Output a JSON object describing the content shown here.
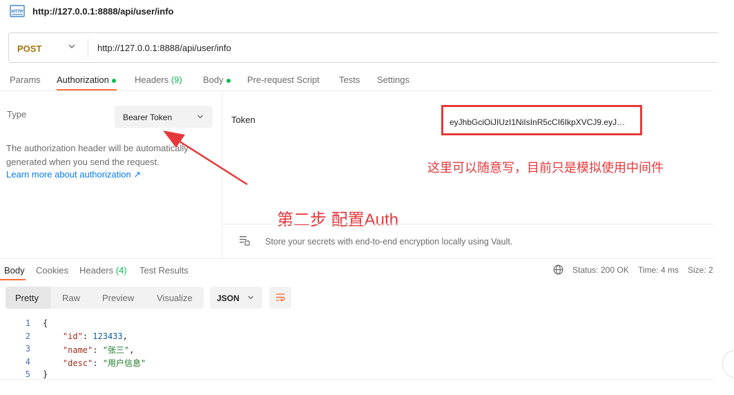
{
  "title": {
    "icon": "http-file-icon",
    "text": "http://127.0.0.1:8888/api/user/info"
  },
  "request": {
    "method": "POST",
    "url": "http://127.0.0.1:8888/api/user/info"
  },
  "tabs": [
    {
      "label": "Params"
    },
    {
      "label": "Authorization",
      "dot": true
    },
    {
      "label": "Headers",
      "count": "(9)"
    },
    {
      "label": "Body",
      "dot": true
    },
    {
      "label": "Pre-request Script"
    },
    {
      "label": "Tests"
    },
    {
      "label": "Settings"
    }
  ],
  "auth": {
    "type_label": "Type",
    "type_value": "Bearer Token",
    "description": "The authorization header will be automatically generated when you send the request.",
    "learn_more": "Learn more about authorization ↗",
    "token_label": "Token",
    "token_value": "eyJhbGciOiJIUzI1NiIsInR5cCI6IkpXVCJ9.eyJ…"
  },
  "annotations": {
    "token_note": "这里可以随意写，目前只是模拟使用中间件",
    "step_note": "第二步 配置Auth"
  },
  "vault_banner": "Store your secrets with end-to-end encryption locally using Vault.",
  "response": {
    "tabs": [
      {
        "label": "Body"
      },
      {
        "label": "Cookies"
      },
      {
        "label": "Headers",
        "count": "(4)"
      },
      {
        "label": "Test Results"
      }
    ],
    "status_label": "Status:",
    "status_value": "200 OK",
    "time_label": "Time:",
    "time_value": "4 ms",
    "size_label": "Size:",
    "size_value": "2",
    "formats": [
      "Pretty",
      "Raw",
      "Preview",
      "Visualize"
    ],
    "language": "JSON",
    "line_numbers": [
      "1",
      "2",
      "3",
      "4",
      "5"
    ],
    "json": {
      "id_key": "\"id\"",
      "id_value": "123433",
      "name_key": "\"name\"",
      "name_value": "\"张三\"",
      "desc_key": "\"desc\"",
      "desc_value": "\"用户信息\""
    }
  },
  "colors": {
    "accent": "#ff6c37",
    "method": "#a5710c",
    "success": "#0cbb52",
    "link": "#097bed",
    "annotation": "#e5383b"
  }
}
